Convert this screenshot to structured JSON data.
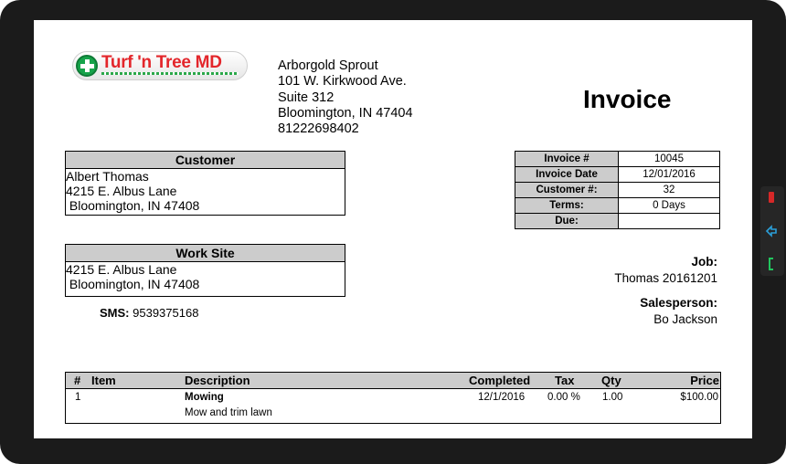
{
  "logo": {
    "name": "Turf 'n Tree MD"
  },
  "company": {
    "name": "Arborgold Sprout",
    "address1": "101 W. Kirkwood Ave.",
    "address2": "Suite 312",
    "city_state_zip": "Bloomington, IN 47404",
    "phone": "81222698402"
  },
  "title": "Invoice",
  "customer": {
    "header": "Customer",
    "name": "Albert Thomas",
    "address": "4215 E. Albus Lane",
    "city_state_zip": " Bloomington, IN 47408"
  },
  "work_site": {
    "header": "Work Site",
    "address": "4215 E. Albus Lane",
    "city_state_zip": " Bloomington, IN 47408"
  },
  "sms": {
    "label": "SMS:",
    "value": "9539375168"
  },
  "invoice_info": [
    {
      "label": "Invoice #",
      "value": "10045"
    },
    {
      "label": "Invoice Date",
      "value": "12/01/2016"
    },
    {
      "label": "Customer #:",
      "value": "32"
    },
    {
      "label": "Terms:",
      "value": "0 Days"
    },
    {
      "label": "Due:",
      "value": ""
    }
  ],
  "job": {
    "label": "Job:",
    "value": "Thomas 20161201"
  },
  "salesperson": {
    "label": "Salesperson:",
    "value": "Bo Jackson"
  },
  "items": {
    "columns": [
      "#",
      "Item",
      "Description",
      "Completed",
      "Tax",
      "Qty",
      "Price"
    ],
    "rows": [
      {
        "num": "1",
        "item": "",
        "description": "Mowing",
        "detail": "Mow and trim lawn",
        "completed": "12/1/2016",
        "tax": "0.00 %",
        "qty": "1.00",
        "price": "$100.00"
      }
    ]
  },
  "device_buttons": [
    "power-icon",
    "back-icon",
    "call-icon"
  ],
  "colors": {
    "header_gray": "#cccccc",
    "logo_red": "#e3262b",
    "logo_green": "#16a34a"
  }
}
